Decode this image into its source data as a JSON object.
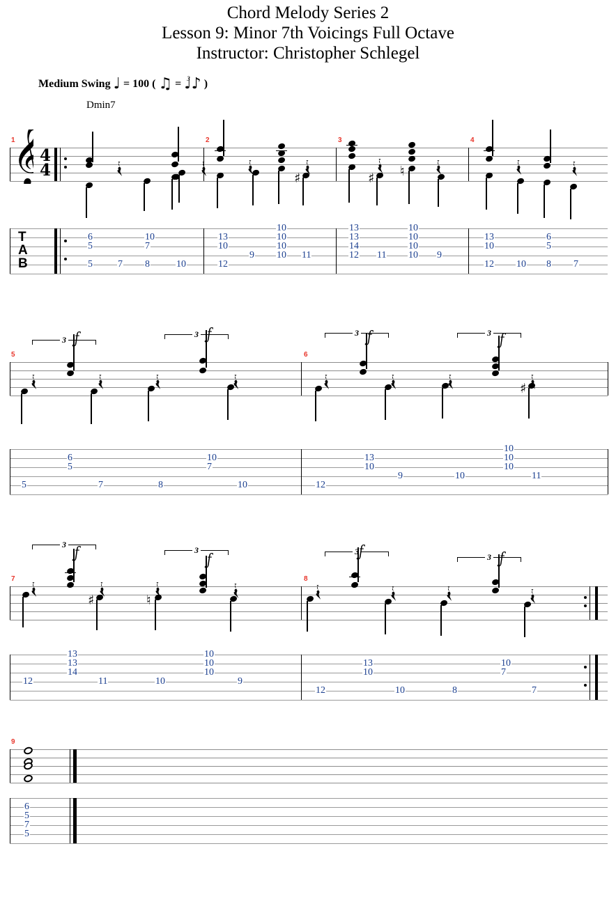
{
  "titles": {
    "line1": "Chord Melody Series 2",
    "line2": "Lesson 9: Minor 7th Voicings Full Octave",
    "line3": "Instructor:  Christopher Schlegel"
  },
  "tempo": {
    "style": "Medium Swing",
    "equals": "= 100",
    "open_paren": "(",
    "swing_equals": "=",
    "close_paren": ")",
    "triplet_label": "3"
  },
  "chord_symbols": [
    {
      "label": "Dmin7"
    }
  ],
  "clefs": {
    "treble": "treble-clef",
    "tab": "TAB",
    "tab_letters": [
      "T",
      "A",
      "B"
    ]
  },
  "time_signature": {
    "top": "4",
    "bottom": "4"
  },
  "measure_numbers": [
    "1",
    "2",
    "3",
    "4",
    "5",
    "6",
    "7",
    "8",
    "9"
  ],
  "triplet_marks": {
    "number": "3"
  },
  "colors": {
    "tab_number": "#1b3f8f",
    "measure_number": "#e8352b",
    "staff_line": "#9a9a9a",
    "ink": "#000000"
  },
  "systems": [
    {
      "name": "system-1",
      "measures": [
        "1",
        "2",
        "3",
        "4"
      ],
      "tab": [
        {
          "measure": "1",
          "stack": [
            {
              "string": 2,
              "fret": "6"
            },
            {
              "string": 3,
              "fret": "5"
            },
            {
              "string": 5,
              "fret": "5"
            }
          ]
        },
        {
          "measure": "1",
          "stack": [
            {
              "string": 5,
              "fret": "7"
            }
          ]
        },
        {
          "measure": "1",
          "stack": [
            {
              "string": 2,
              "fret": "10"
            },
            {
              "string": 3,
              "fret": "7"
            },
            {
              "string": 5,
              "fret": "8"
            }
          ]
        },
        {
          "measure": "1",
          "stack": [
            {
              "string": 5,
              "fret": "10"
            }
          ]
        },
        {
          "measure": "2",
          "stack": [
            {
              "string": 2,
              "fret": "13"
            },
            {
              "string": 3,
              "fret": "10"
            },
            {
              "string": 5,
              "fret": "12"
            }
          ]
        },
        {
          "measure": "2",
          "stack": [
            {
              "string": 4,
              "fret": "9"
            }
          ]
        },
        {
          "measure": "2",
          "stack": [
            {
              "string": 1,
              "fret": "10"
            },
            {
              "string": 2,
              "fret": "10"
            },
            {
              "string": 3,
              "fret": "10"
            },
            {
              "string": 4,
              "fret": "10"
            }
          ]
        },
        {
          "measure": "2",
          "stack": [
            {
              "string": 4,
              "fret": "11"
            }
          ]
        },
        {
          "measure": "3",
          "stack": [
            {
              "string": 1,
              "fret": "13"
            },
            {
              "string": 2,
              "fret": "13"
            },
            {
              "string": 3,
              "fret": "14"
            },
            {
              "string": 4,
              "fret": "12"
            }
          ]
        },
        {
          "measure": "3",
          "stack": [
            {
              "string": 4,
              "fret": "11"
            }
          ]
        },
        {
          "measure": "3",
          "stack": [
            {
              "string": 1,
              "fret": "10"
            },
            {
              "string": 2,
              "fret": "10"
            },
            {
              "string": 3,
              "fret": "10"
            },
            {
              "string": 4,
              "fret": "10"
            }
          ]
        },
        {
          "measure": "3",
          "stack": [
            {
              "string": 4,
              "fret": "9"
            }
          ]
        },
        {
          "measure": "4",
          "stack": [
            {
              "string": 2,
              "fret": "13"
            },
            {
              "string": 3,
              "fret": "10"
            },
            {
              "string": 5,
              "fret": "12"
            }
          ]
        },
        {
          "measure": "4",
          "stack": [
            {
              "string": 5,
              "fret": "10"
            }
          ]
        },
        {
          "measure": "4",
          "stack": [
            {
              "string": 2,
              "fret": "6"
            },
            {
              "string": 3,
              "fret": "5"
            },
            {
              "string": 5,
              "fret": "8"
            }
          ]
        },
        {
          "measure": "4",
          "stack": [
            {
              "string": 5,
              "fret": "7"
            }
          ]
        }
      ]
    },
    {
      "name": "system-2",
      "measures": [
        "5",
        "6"
      ],
      "tab": [
        {
          "measure": "5",
          "stack": [
            {
              "string": 5,
              "fret": "5"
            }
          ]
        },
        {
          "measure": "5",
          "stack": [
            {
              "string": 2,
              "fret": "6"
            },
            {
              "string": 3,
              "fret": "5"
            }
          ]
        },
        {
          "measure": "5",
          "stack": [
            {
              "string": 5,
              "fret": "7"
            }
          ]
        },
        {
          "measure": "5",
          "stack": [
            {
              "string": 5,
              "fret": "8"
            }
          ]
        },
        {
          "measure": "5",
          "stack": [
            {
              "string": 2,
              "fret": "10"
            },
            {
              "string": 3,
              "fret": "7"
            }
          ]
        },
        {
          "measure": "5",
          "stack": [
            {
              "string": 5,
              "fret": "10"
            }
          ]
        },
        {
          "measure": "6",
          "stack": [
            {
              "string": 5,
              "fret": "12"
            }
          ]
        },
        {
          "measure": "6",
          "stack": [
            {
              "string": 2,
              "fret": "13"
            },
            {
              "string": 3,
              "fret": "10"
            }
          ]
        },
        {
          "measure": "6",
          "stack": [
            {
              "string": 4,
              "fret": "9"
            }
          ]
        },
        {
          "measure": "6",
          "stack": [
            {
              "string": 4,
              "fret": "10"
            }
          ]
        },
        {
          "measure": "6",
          "stack": [
            {
              "string": 1,
              "fret": "10"
            },
            {
              "string": 2,
              "fret": "10"
            },
            {
              "string": 3,
              "fret": "10"
            }
          ]
        },
        {
          "measure": "6",
          "stack": [
            {
              "string": 4,
              "fret": "11"
            }
          ]
        }
      ]
    },
    {
      "name": "system-3",
      "measures": [
        "7",
        "8"
      ],
      "tab": [
        {
          "measure": "7",
          "stack": [
            {
              "string": 4,
              "fret": "12"
            }
          ]
        },
        {
          "measure": "7",
          "stack": [
            {
              "string": 1,
              "fret": "13"
            },
            {
              "string": 2,
              "fret": "13"
            },
            {
              "string": 3,
              "fret": "14"
            }
          ]
        },
        {
          "measure": "7",
          "stack": [
            {
              "string": 4,
              "fret": "11"
            }
          ]
        },
        {
          "measure": "7",
          "stack": [
            {
              "string": 4,
              "fret": "10"
            }
          ]
        },
        {
          "measure": "7",
          "stack": [
            {
              "string": 1,
              "fret": "10"
            },
            {
              "string": 2,
              "fret": "10"
            },
            {
              "string": 3,
              "fret": "10"
            }
          ]
        },
        {
          "measure": "7",
          "stack": [
            {
              "string": 4,
              "fret": "9"
            }
          ]
        },
        {
          "measure": "8",
          "stack": [
            {
              "string": 5,
              "fret": "12"
            }
          ]
        },
        {
          "measure": "8",
          "stack": [
            {
              "string": 2,
              "fret": "13"
            },
            {
              "string": 3,
              "fret": "10"
            }
          ]
        },
        {
          "measure": "8",
          "stack": [
            {
              "string": 5,
              "fret": "10"
            }
          ]
        },
        {
          "measure": "8",
          "stack": [
            {
              "string": 5,
              "fret": "8"
            }
          ]
        },
        {
          "measure": "8",
          "stack": [
            {
              "string": 2,
              "fret": "10"
            },
            {
              "string": 3,
              "fret": "7"
            }
          ]
        },
        {
          "measure": "8",
          "stack": [
            {
              "string": 5,
              "fret": "7"
            }
          ]
        }
      ]
    },
    {
      "name": "system-4",
      "measures": [
        "9"
      ],
      "tab": [
        {
          "measure": "9",
          "stack": [
            {
              "string": 2,
              "fret": "6"
            },
            {
              "string": 3,
              "fret": "5"
            },
            {
              "string": 4,
              "fret": "7"
            },
            {
              "string": 5,
              "fret": "5"
            }
          ]
        }
      ]
    }
  ]
}
